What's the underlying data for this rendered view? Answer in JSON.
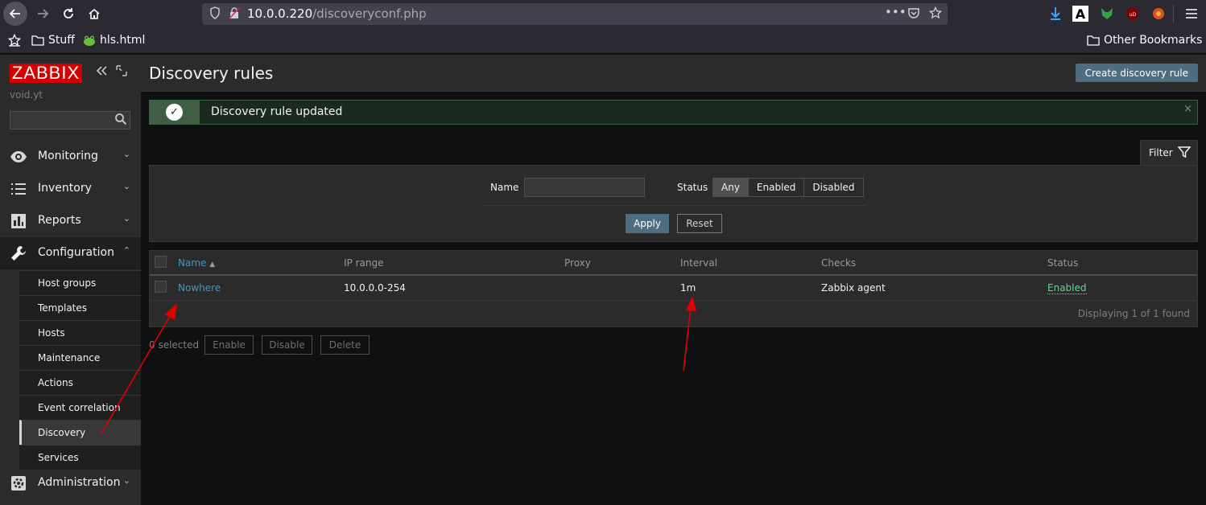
{
  "browser": {
    "url_host": "10.0.0.220",
    "url_path": "/discoveryconf.php",
    "bookmarks": [
      {
        "label": "Stuff",
        "icon": "folder-icon"
      },
      {
        "label": "hls.html",
        "icon": "frog-icon"
      }
    ],
    "other_bookmarks": "Other Bookmarks"
  },
  "sidebar": {
    "logo": "ZABBIX",
    "server_name": "void.yt",
    "search_value": "",
    "menu": [
      {
        "label": "Monitoring",
        "icon": "eye-icon"
      },
      {
        "label": "Inventory",
        "icon": "list-icon"
      },
      {
        "label": "Reports",
        "icon": "chart-icon"
      },
      {
        "label": "Configuration",
        "icon": "wrench-icon"
      },
      {
        "label": "Administration",
        "icon": "cog-icon"
      }
    ],
    "config_submenu": [
      "Host groups",
      "Templates",
      "Hosts",
      "Maintenance",
      "Actions",
      "Event correlation",
      "Discovery",
      "Services"
    ],
    "selected_submenu": "Discovery"
  },
  "header": {
    "title": "Discovery rules",
    "create_button": "Create discovery rule"
  },
  "message": {
    "text": "Discovery rule updated",
    "close": "×"
  },
  "filter": {
    "tab_label": "Filter",
    "name_label": "Name",
    "name_value": "",
    "status_label": "Status",
    "status_options": [
      "Any",
      "Enabled",
      "Disabled"
    ],
    "status_selected": "Any",
    "apply": "Apply",
    "reset": "Reset"
  },
  "table": {
    "columns": [
      "Name",
      "IP range",
      "Proxy",
      "Interval",
      "Checks",
      "Status"
    ],
    "sort_indicator": "▲",
    "rows": [
      {
        "name": "Nowhere",
        "ip_range": "10.0.0.0-254",
        "proxy": "",
        "interval": "1m",
        "checks": "Zabbix agent",
        "status": "Enabled"
      }
    ],
    "footer": "Displaying 1 of 1 found"
  },
  "mass_actions": {
    "selected": "0 selected",
    "buttons": [
      "Enable",
      "Disable",
      "Delete"
    ]
  },
  "colors": {
    "brand": "#d40000",
    "link": "#4796c4",
    "enabled": "#59db8f",
    "primary_button": "#4f6d80",
    "annotation_arrow": "#e00000"
  }
}
